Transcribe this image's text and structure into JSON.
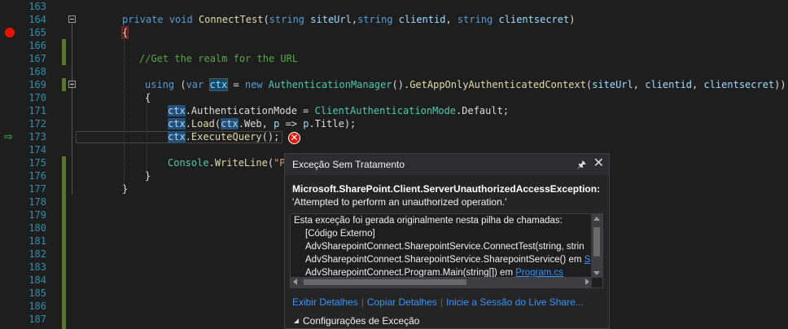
{
  "gutter": {
    "line_numbers": [
      "163",
      "164",
      "165",
      "166",
      "167",
      "168",
      "169",
      "170",
      "171",
      "172",
      "173",
      "174",
      "175",
      "176",
      "177",
      "178",
      "179",
      "180",
      "181",
      "182",
      "183",
      "184",
      "185",
      "186",
      "187"
    ]
  },
  "code": {
    "l164": {
      "kw1": "private",
      "kw2": "void",
      "method": "ConnectTest",
      "p1": "(",
      "t1": "string",
      "v1": "siteUrl",
      "c1": ",",
      "t2": "string",
      "v2": "clientid",
      "c2": ", ",
      "t3": "string",
      "v3": "clientsecret",
      "p2": ")"
    },
    "l165": {
      "brace": "{"
    },
    "l167": {
      "comment": "//Get the realm for the URL"
    },
    "l169": {
      "kw_using": "using",
      "p1": " (",
      "kw_var": "var",
      "ctx": "ctx",
      "eq": " = ",
      "kw_new": "new",
      "type": "AuthenticationManager",
      "p2": "().",
      "method": "GetAppOnlyAuthenticatedContext",
      "p3": "(",
      "a1": "siteUrl",
      "c1": ", ",
      "a2": "clientid",
      "c2": ", ",
      "a3": "clientsecret",
      "p4": "))"
    },
    "l170": {
      "brace": "{"
    },
    "l171": {
      "ctx": "ctx",
      "rest1": ".AuthenticationMode = ",
      "type": "ClientAuthenticationMode",
      "rest2": ".Default;"
    },
    "l172": {
      "ctx": "ctx",
      "dot": ".",
      "method": "Load",
      "p1": "(",
      "ctx2": "ctx",
      "rest": ".Web, ",
      "p": "p",
      "arrow": " => ",
      "p2": "p",
      "rest2": ".Title);"
    },
    "l173": {
      "ctx": "ctx",
      "dot": ".",
      "method": "ExecuteQuery",
      "rest": "();"
    },
    "l175": {
      "type": "Console",
      "dot": ".",
      "method": "WriteLine",
      "p1": "(",
      "str": "\"P"
    },
    "l176": {
      "brace": "}"
    },
    "l177": {
      "brace": "}"
    }
  },
  "popup": {
    "title": "Exceção Sem Tratamento",
    "pin_icon": "pin-icon",
    "close_icon": "close-icon",
    "exception_type": "Microsoft.SharePoint.Client.ServerUnauthorizedAccessException:",
    "exception_message": "'Attempted to perform an unauthorized operation.'",
    "stack": {
      "header": "Esta exceção foi gerada originalmente nesta pilha de chamadas:",
      "frame1": "[Código Externo]",
      "frame2": "AdvSharepointConnect.SharepointService.ConnectTest(string, strin",
      "frame3_text": "AdvSharepointConnect.SharepointService.SharepointService() em ",
      "frame3_link": "S",
      "frame4_text": "AdvSharepointConnect.Program.Main(string[]) em ",
      "frame4_link": "Program.cs"
    },
    "actions": {
      "view_details": "Exibir Detalhes",
      "copy_details": "Copiar Detalhes",
      "live_share": "Inicie a Sessão do Live Share..."
    },
    "settings_label": "Configurações de Exceção"
  },
  "colors": {
    "editor_bg": "#1e1e1e",
    "line_number": "#2b91af",
    "keyword": "#569cd6",
    "type": "#4ec9b0",
    "method": "#dcdcaa",
    "comment": "#57a64a",
    "link": "#3794ff",
    "breakpoint": "#e51400"
  }
}
